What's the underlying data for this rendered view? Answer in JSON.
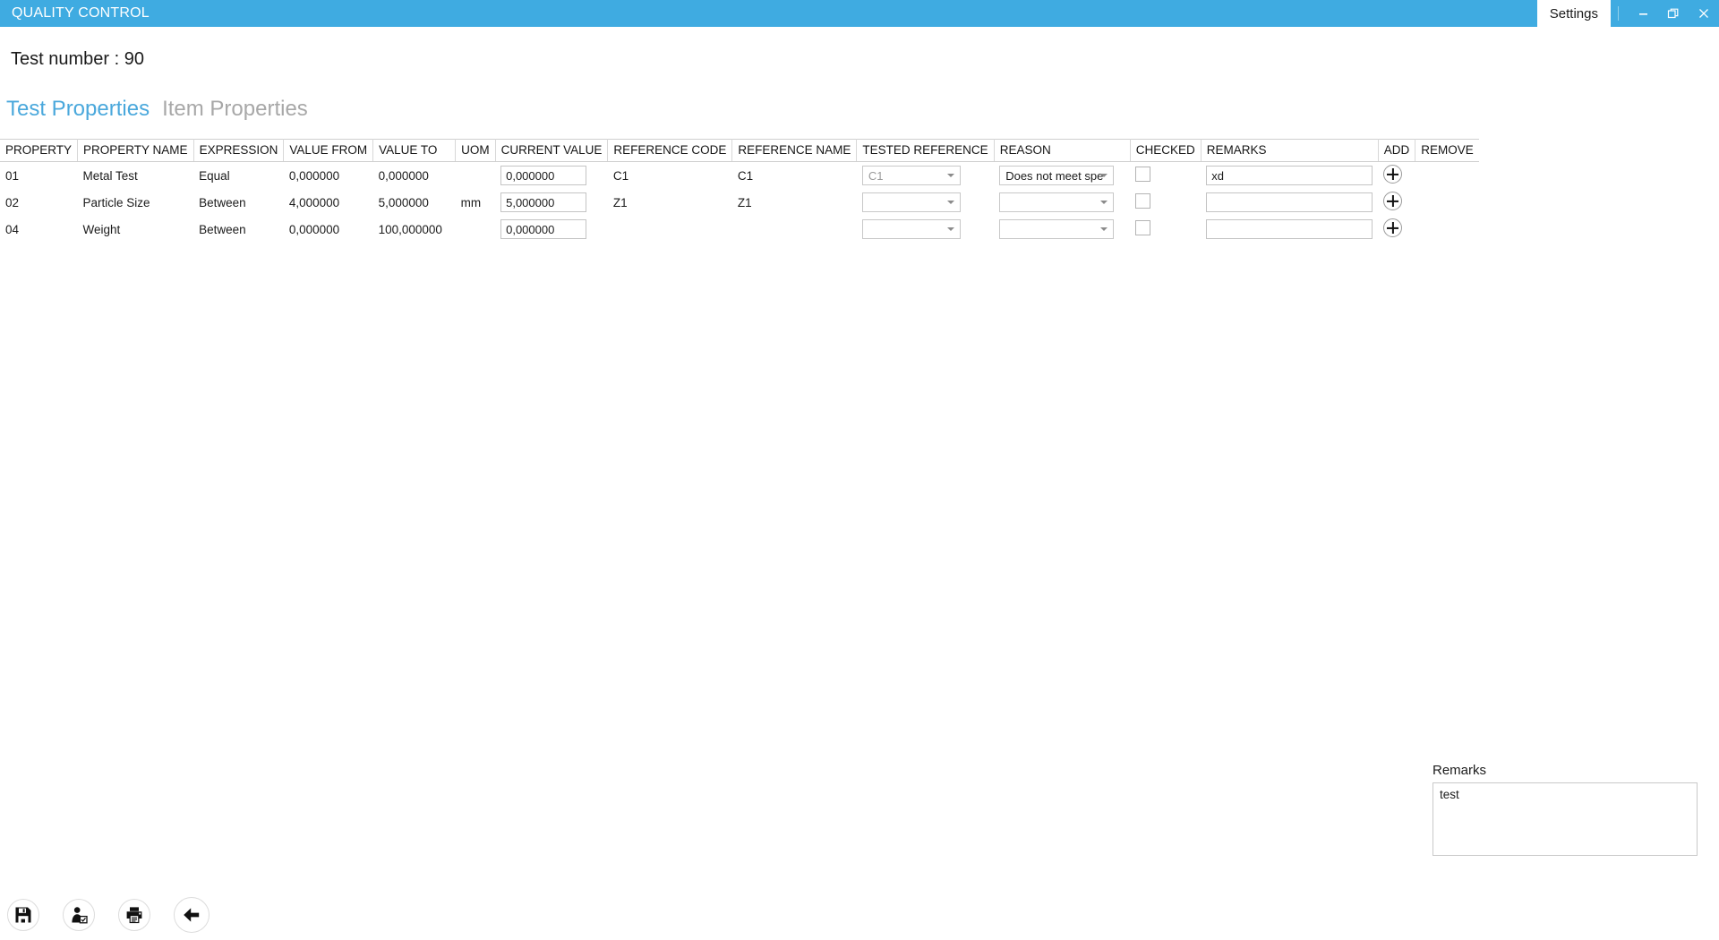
{
  "titlebar": {
    "app_title": "QUALITY CONTROL",
    "settings_tab": "Settings",
    "minimize_icon": "minimize-icon",
    "restore_icon": "restore-icon",
    "close_icon": "close-icon",
    "accent_color": "#3fabe1"
  },
  "header": {
    "test_number_label": "Test number : 90"
  },
  "tabs": [
    {
      "label": "Test Properties",
      "active": true
    },
    {
      "label": "Item Properties",
      "active": false
    }
  ],
  "table": {
    "columns": [
      "PROPERTY",
      "PROPERTY NAME",
      "EXPRESSION",
      "VALUE FROM",
      "VALUE TO",
      "UOM",
      "CURRENT VALUE",
      "REFERENCE CODE",
      "REFERENCE NAME",
      "TESTED REFERENCE",
      "REASON",
      "CHECKED",
      "REMARKS",
      "ADD",
      "REMOVE"
    ],
    "rows": [
      {
        "property": "01",
        "property_name": "Metal Test",
        "expression": "Equal",
        "value_from": "0,000000",
        "value_to": "0,000000",
        "uom": "",
        "current_value": "0,000000",
        "reference_code": "C1",
        "reference_name": "C1",
        "tested_reference": "C1",
        "tested_reference_muted": true,
        "reason": "Does not meet spe",
        "checked": false,
        "remarks": "xd",
        "add_icon": "plus-circle-icon"
      },
      {
        "property": "02",
        "property_name": "Particle Size",
        "expression": "Between",
        "value_from": "4,000000",
        "value_to": "5,000000",
        "uom": "mm",
        "current_value": "5,000000",
        "reference_code": "Z1",
        "reference_name": "Z1",
        "tested_reference": "",
        "tested_reference_muted": false,
        "reason": "",
        "checked": false,
        "remarks": "",
        "add_icon": "plus-circle-icon"
      },
      {
        "property": "04",
        "property_name": "Weight",
        "expression": "Between",
        "value_from": "0,000000",
        "value_to": "100,000000",
        "uom": "",
        "current_value": "0,000000",
        "reference_code": "",
        "reference_name": "",
        "tested_reference": "",
        "tested_reference_muted": false,
        "reason": "",
        "checked": false,
        "remarks": "",
        "add_icon": "plus-circle-icon"
      }
    ]
  },
  "remarks_panel": {
    "label": "Remarks",
    "value": "test",
    "placeholder": ""
  },
  "toolbar": {
    "buttons": [
      {
        "name": "save-button",
        "icon": "floppy-disk-icon"
      },
      {
        "name": "assign-user-button",
        "icon": "user-check-icon"
      },
      {
        "name": "print-button",
        "icon": "printer-icon"
      },
      {
        "name": "back-button",
        "icon": "arrow-left-icon"
      }
    ]
  }
}
